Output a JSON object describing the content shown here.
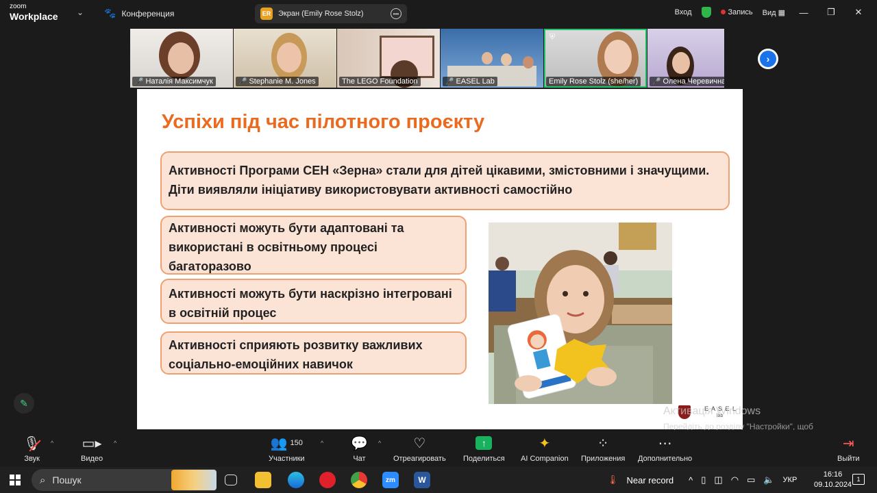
{
  "topbar": {
    "brand_small": "zoom",
    "brand_large": "Workplace",
    "conference_label": "Конференция",
    "screen_badge": "ER",
    "screen_label": "Экран (Emily Rose Stolz)",
    "signin": "Вход",
    "record": "Запись",
    "view": "Вид"
  },
  "gallery": {
    "participants": [
      {
        "name": "Наталія Максимчук"
      },
      {
        "name": "Stephanie M. Jones"
      },
      {
        "name": "The LEGO Foundation"
      },
      {
        "name": "EASEL Lab"
      },
      {
        "name": "Emily Rose Stolz (she/her)"
      },
      {
        "name": "Олена Черевична"
      }
    ]
  },
  "slide": {
    "title": "Успіхи під час пілотного проєкту",
    "box1": "Активності Програми СЕН «Зерна» стали для дітей цікавими, змістовними і значущими. Діти виявляли ініціативу використовувати активності самостійно",
    "box2": "Активності можуть бути адаптовані та використані в освітньому процесі багаторазово",
    "box3": "Активності можуть бути наскрізно інтегровані в освітній процес",
    "box4": "Активності сприяють розвитку важливих соціально-емоційних навичок",
    "logo_text": "E A S E L",
    "logo_sub": "lab"
  },
  "watermark": {
    "line1": "Активація Windows",
    "line2": "Перейдіть до розділу \"Настройки\", щоб активувати Windows."
  },
  "toolbar": {
    "audio": "Звук",
    "video": "Видео",
    "participants": "Участники",
    "participants_count": "150",
    "chat": "Чат",
    "react": "Отреагировать",
    "share": "Поделиться",
    "ai": "AI Companion",
    "apps": "Приложения",
    "more": "Дополнительно",
    "leave": "Выйти"
  },
  "taskbar": {
    "search_placeholder": "Пошук",
    "weather": "Near record",
    "language": "УКР",
    "time": "16:16",
    "date": "09.10.2024",
    "notif_count": "1"
  }
}
